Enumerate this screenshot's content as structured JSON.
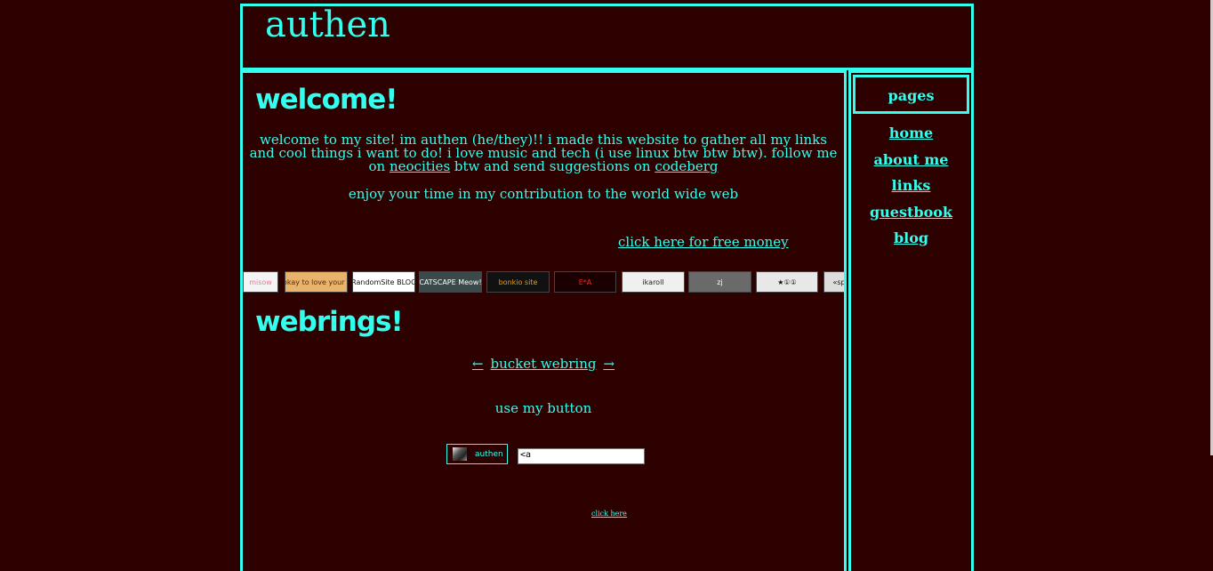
{
  "header": {
    "title": "authen"
  },
  "welcome": {
    "heading": "welcome!",
    "text_part1": "welcome to my site! im authen (he/they)!! i made this website to gather all my links and cool things i want to do! i love music and tech (i use linux btw btw btw). follow me on ",
    "neocities_link": "neocities",
    "text_part2": " btw and send suggestions on ",
    "codeberg_link": "codeberg",
    "enjoy": "enjoy your time in my contribution to the world wide web",
    "free_money_link": "click here for free money"
  },
  "buttons": [
    {
      "label": "misow",
      "bg": "#f4f4f4",
      "fg": "#e07aa0"
    },
    {
      "label": "it's okay to love your bros",
      "bg": "#e8b36a",
      "fg": "#5a2a10"
    },
    {
      "label": "ARandomSite BLOGS",
      "bg": "#ffffff",
      "fg": "#111111"
    },
    {
      "label": "CATSCAPE Meow!",
      "bg": "#3a4a4a",
      "fg": "#ffffff"
    },
    {
      "label": "bonkio site",
      "bg": "#111111",
      "fg": "#e0a020"
    },
    {
      "label": "E*A",
      "bg": "#1a0000",
      "fg": "#ff2020"
    },
    {
      "label": "ikaroll",
      "bg": "#f0f0f0",
      "fg": "#222222"
    },
    {
      "label": "zj",
      "bg": "#6a6a6a",
      "fg": "#ffffff"
    },
    {
      "label": "★①①",
      "bg": "#e8e8e8",
      "fg": "#111111"
    },
    {
      "label": "«spe",
      "bg": "#dddddd",
      "fg": "#111111"
    }
  ],
  "webrings": {
    "heading": "webrings!",
    "prev": "←",
    "ring_name": "bucket webring",
    "next": "→",
    "use_button_text": "use my button",
    "my_button_label": "authen",
    "code_value": "<a",
    "click_here_link": "click here"
  },
  "sidebar": {
    "title": "pages",
    "items": [
      {
        "label": "home"
      },
      {
        "label": "about me"
      },
      {
        "label": "links"
      },
      {
        "label": "guestbook"
      },
      {
        "label": "blog"
      }
    ]
  },
  "colors": {
    "background": "#2e0101",
    "accent": "#33ffee"
  }
}
